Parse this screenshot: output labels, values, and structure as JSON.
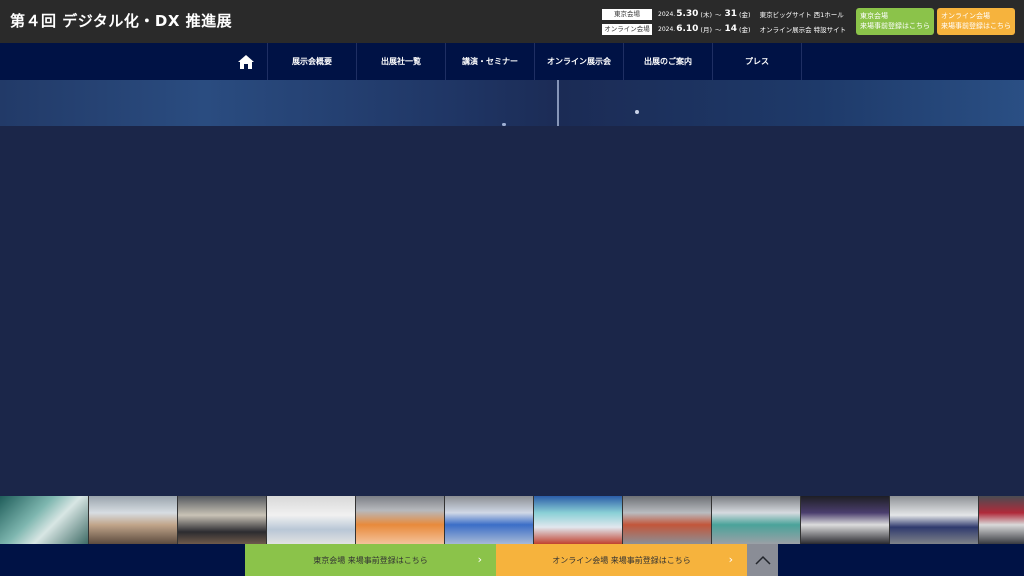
{
  "header": {
    "title": "第４回 デジタル化・DX 推進展",
    "tokyo": {
      "tag": "東京会場",
      "year": "2024.",
      "start": "5.30",
      "start_day": "(木)",
      "sep": "～",
      "end": "31",
      "end_day": "(金)",
      "place": "東京ビッグサイト 西1ホール"
    },
    "online": {
      "tag": "オンライン会場",
      "year": "2024.",
      "start": "6.10",
      "start_day": "(月)",
      "sep": "～",
      "end": "14",
      "end_day": "(金)",
      "place": "オンライン展示会 特設サイト"
    },
    "btn_tokyo_line1": "東京会場",
    "btn_tokyo_line2": "来場事前登録はこちら",
    "btn_online_line1": "オンライン会場",
    "btn_online_line2": "来場事前登録はこちら"
  },
  "nav": {
    "home_icon": "home-icon",
    "items": [
      "展示会概要",
      "出展社一覧",
      "講演・セミナー",
      "オンライン展示会",
      "出展のご案内",
      "プレス"
    ]
  },
  "footer": {
    "btn_tokyo": "東京会場 来場事前登録はこちら",
    "btn_online": "オンライン会場 来場事前登録はこちら",
    "arrow_icon": "chevron-right-icon",
    "top_icon": "chevron-up-icon"
  },
  "colors": {
    "green": "#8bc34a",
    "orange": "#f6b33d",
    "navy": "#001245",
    "main_bg": "#1b2649"
  }
}
